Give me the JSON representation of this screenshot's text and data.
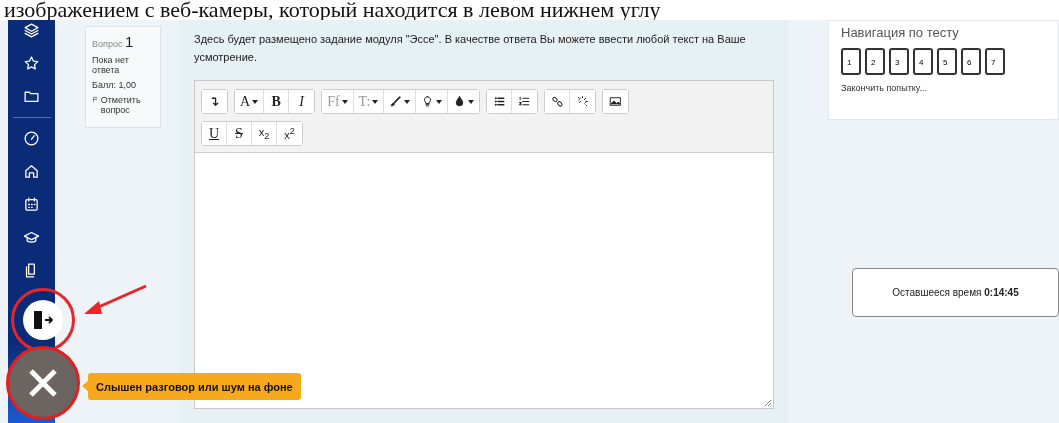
{
  "caption": "изображением с веб-камеры, который находится в левом нижнем углу",
  "question_info": {
    "label": "Вопрос",
    "number": "1",
    "status": "Пока нет ответа",
    "grade": "Балл: 1,00",
    "flag": "Отметить вопрос"
  },
  "question_text": "Здесь будет размещено задание модуля \"Эссе\". В качестве ответа Вы можете ввести любой текст на Ваше усмотрение.",
  "toolbar_rows": [
    [
      [
        {
          "kind": "collapse"
        }
      ],
      [
        {
          "kind": "font-color",
          "label": "A"
        },
        {
          "kind": "bold",
          "label": "B"
        },
        {
          "kind": "italic",
          "label": "I"
        }
      ],
      [
        {
          "kind": "font-family",
          "label": "Ff"
        },
        {
          "kind": "font-size",
          "label": "T:"
        },
        {
          "kind": "brush"
        },
        {
          "kind": "bulb"
        },
        {
          "kind": "drop"
        }
      ],
      [
        {
          "kind": "bullets"
        },
        {
          "kind": "numbers"
        }
      ],
      [
        {
          "kind": "link"
        },
        {
          "kind": "unlink"
        }
      ],
      [
        {
          "kind": "image"
        }
      ]
    ],
    [
      [
        {
          "kind": "underline",
          "label": "U"
        },
        {
          "kind": "strike",
          "label": "S"
        },
        {
          "kind": "subscript",
          "label": "x$_{2}$"
        },
        {
          "kind": "superscript",
          "label": "x$^{2}$"
        }
      ]
    ]
  ],
  "navigation": {
    "title": "Навигация по тесту",
    "buttons": [
      "1",
      "2",
      "3",
      "4",
      "5",
      "6",
      "7"
    ],
    "finish": "Закончить попытку..."
  },
  "timer": "Оставшееся время **0:14:45**",
  "alert": "Слышен разговор или шум на фоне"
}
